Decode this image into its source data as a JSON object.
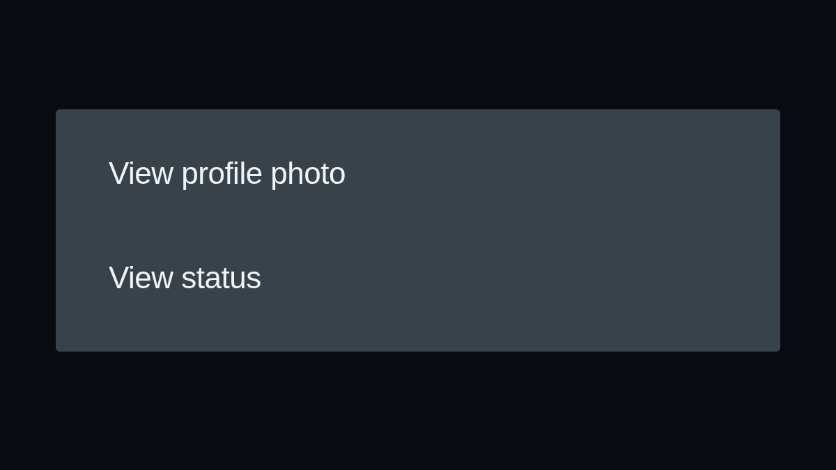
{
  "menu": {
    "items": [
      {
        "label": "View profile photo"
      },
      {
        "label": "View status"
      }
    ]
  }
}
